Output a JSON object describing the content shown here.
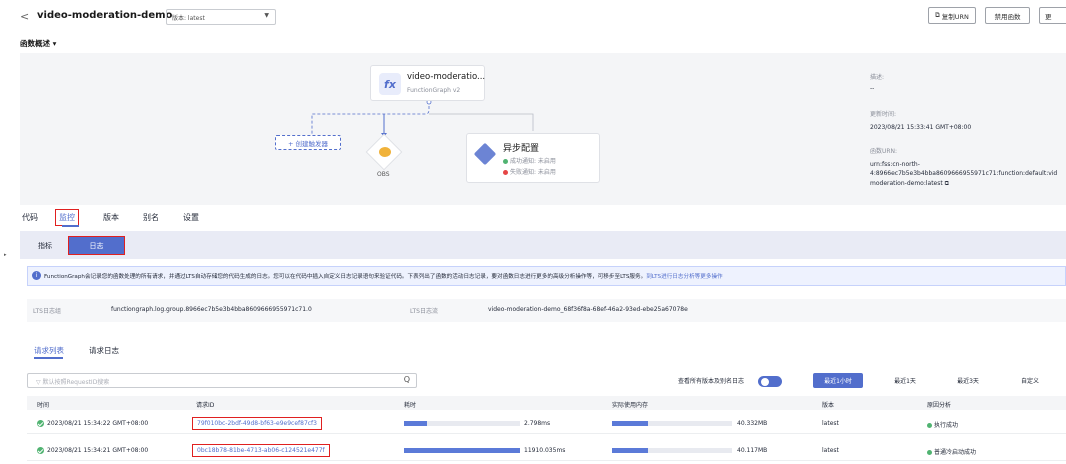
{
  "header": {
    "back": "<",
    "title": "video-moderation-demo",
    "version": "版本: latest",
    "copy_urn": "复制URN",
    "disable": "禁用函数",
    "more": "更"
  },
  "overview": {
    "heading": "函数概述 ▾",
    "fn_name": "video-moderatio...",
    "fn_sub": "FunctionGraph v2",
    "trigger": "+ 创建触发器",
    "obs": "OBS",
    "async_title": "异步配置",
    "async_ok": "成功通知: 未启用",
    "async_fail": "失败通知: 未启用",
    "desc_label": "描述:",
    "desc_value": "--",
    "updated_label": "更新时间:",
    "updated_value": "2023/08/21 15:33:41 GMT+08:00",
    "urn_label": "函数URN:",
    "urn_l1": "urn:fss:cn-north-",
    "urn_l2": "4:8966ec7b5e3b4bba8609666955971c71:function:default:vid",
    "urn_l3": "moderation-demo:latest"
  },
  "tabs": [
    "代码",
    "监控",
    "版本",
    "别名",
    "设置"
  ],
  "subtabs": [
    "指标",
    "日志"
  ],
  "notice": "FunctionGraph会记录您的函数处理的所有请求，并通过LTS自动存储您的代码生成的日志。您可以在代码中插入自定义日志记录语句来验证代码。下表列出了函数的活动日志记录，要对函数日志进行更多的高级分析操作等，可移步至LTS服务。",
  "notice_link": "到LTS进行日志分析等更多操作",
  "lts": {
    "group_label": "LTS日志组",
    "group_value": "functiongraph.log.group.8966ec7b5e3b4bba8609666955971c71.0",
    "stream_label": "LTS日志流",
    "stream_value": "video-moderation-demo_68f36f8a-68ef-46a2-93ed-ebe25a67078e"
  },
  "list_tabs": [
    "请求列表",
    "请求日志"
  ],
  "search_placeholder": "默认按照RequestID搜索",
  "search_icon": "Q",
  "toggle_label": "查看所有版本及别名日志",
  "ranges": [
    "最近1小时",
    "最近1天",
    "最近3天",
    "自定义"
  ],
  "columns": [
    "时间",
    "请求ID",
    "耗时",
    "实际使用内存",
    "版本",
    "原因分析"
  ],
  "rows": [
    {
      "time": "2023/08/21 15:34:22 GMT+08:00",
      "id": "79f010bc-2bdf-49d8-bf63-e9e9cef87cf3",
      "duration": "2.798ms",
      "duration_pct": 0.2,
      "memory": "40.332MB",
      "memory_pct": 0.3,
      "version": "latest",
      "reason": "执行成功",
      "reason_color": "#50b371"
    },
    {
      "time": "2023/08/21 15:34:21 GMT+08:00",
      "id": "0bc18b78-81be-4713-ab06-c124521e477f",
      "duration": "11910.035ms",
      "duration_pct": 1.0,
      "memory": "40.117MB",
      "memory_pct": 0.3,
      "version": "latest",
      "reason": "普通冷启动成功",
      "reason_color": "#50b371"
    }
  ],
  "colors": {
    "accent": "#526ecc",
    "success": "#50b371",
    "fail": "#e54545",
    "highlight": "#e02020"
  }
}
